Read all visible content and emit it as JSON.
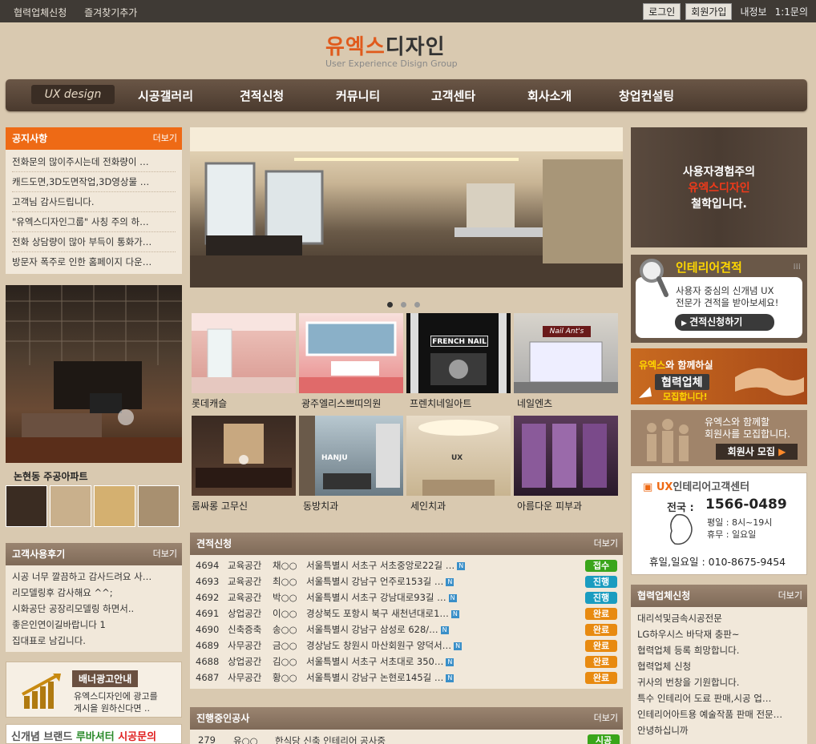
{
  "topbar": {
    "left": [
      "협력업체신청",
      "즐겨찾기추가"
    ],
    "login": "로그인",
    "join": "회원가입",
    "myinfo": "내정보",
    "qna": "1:1문의"
  },
  "logo": {
    "brand_part1": "유엑스",
    "brand_part2": "디자인",
    "sub": "User Experience Disign Group"
  },
  "nav": {
    "home": "UX design",
    "items": [
      "시공갤러리",
      "견적신청",
      "커뮤니티",
      "고객센타",
      "회사소개",
      "창업컨설팅"
    ]
  },
  "notice": {
    "title": "공지사항",
    "more": "더보기",
    "items": [
      "전화문의 많이주시는데 전화량이 …",
      "캐드도면,3D도면작업,3D영상물 …",
      "고객님 감사드립니다.",
      "\"유엑스디자인그룹\" 사칭 주의 하…",
      "전화 상담량이 많아 부득이 통화가…",
      "방문자 폭주로 인한 홈페이지 다운…"
    ]
  },
  "feature": {
    "caption": "논현동 주공아파트"
  },
  "reviews": {
    "title": "고객사용후기",
    "more": "더보기",
    "items": [
      "시공 너무 깔끔하고 감사드려요 사…",
      "리모델링후 감사해요 ^^;",
      "시화공단 공장리모델링 하면서..",
      "좋은인연이길바랍니다 1",
      "집대표로 남깁니다."
    ]
  },
  "banner_ad": {
    "title": "배너광고안내",
    "line1": "유엑스디자인에 광고를",
    "line2": "게시을 원하신다면 .."
  },
  "brand_strip": {
    "text1": "신개념 브랜드",
    "text2": "루바셔터",
    "text3": "시공문의"
  },
  "slider": {
    "dots": 3,
    "active": 0
  },
  "gallery": [
    {
      "caption": "롯데캐슬"
    },
    {
      "caption": "광주엘리스쁘띠의원"
    },
    {
      "caption": "프렌치네일아트"
    },
    {
      "caption": "네일엔츠"
    },
    {
      "caption": "룸싸롱 고무신"
    },
    {
      "caption": "동방치과"
    },
    {
      "caption": "세인치과"
    },
    {
      "caption": "아름다운 피부과"
    }
  ],
  "gallery_signs": {
    "french": "FRENCH NAIL",
    "nailants": "Nail Ant's",
    "hanju": "HANJU",
    "ux": "UX"
  },
  "estimate": {
    "title": "견적신청",
    "more": "더보기",
    "rows": [
      {
        "no": "4694",
        "type": "교육공간",
        "name": "채○○",
        "addr": "서울특별시 서초구 서초중앙로22길 …",
        "status": "접수",
        "color": "#3aa51a"
      },
      {
        "no": "4693",
        "type": "교육공간",
        "name": "최○○",
        "addr": "서울특별시 강남구 언주로153길 …",
        "status": "진행",
        "color": "#1a9cc0"
      },
      {
        "no": "4692",
        "type": "교육공간",
        "name": "박○○",
        "addr": "서울특별시 서초구 강남대로93길 …",
        "status": "진행",
        "color": "#1a9cc0"
      },
      {
        "no": "4691",
        "type": "상업공간",
        "name": "이○○",
        "addr": "경상북도 포항시 북구 새천년대로1…",
        "status": "완료",
        "color": "#e88a10"
      },
      {
        "no": "4690",
        "type": "신축증축",
        "name": "송○○",
        "addr": "서울특별시 강남구 삼성로 628/…",
        "status": "완료",
        "color": "#e88a10"
      },
      {
        "no": "4689",
        "type": "사무공간",
        "name": "금○○",
        "addr": "경상남도 창원시 마산회원구 양덕서…",
        "status": "완료",
        "color": "#e88a10"
      },
      {
        "no": "4688",
        "type": "상업공간",
        "name": "김○○",
        "addr": "서울특별시 서초구 서초대로 350…",
        "status": "완료",
        "color": "#e88a10"
      },
      {
        "no": "4687",
        "type": "사무공간",
        "name": "황○○",
        "addr": "서울특별시 강남구 논현로145길 …",
        "status": "완료",
        "color": "#e88a10"
      }
    ],
    "new_icon": "N"
  },
  "ongoing": {
    "title": "진행중인공사",
    "more": "더보기",
    "row": {
      "no": "279",
      "name": "유○○",
      "desc": "한식당 신축 인테리어 공사중",
      "status": "시공"
    }
  },
  "right": {
    "philosophy": {
      "l1": "사용자경험주의",
      "l2": "유엑스디자인",
      "l3": "철학입니다."
    },
    "quote": {
      "title": "인테리어견적",
      "l1": "사용자 중심의 신개념 UX",
      "l2": "전문가 견적을 받아보세요!",
      "btn": "견적신청하기"
    },
    "partner": {
      "l1a": "유엑스",
      "l1b": "와 함께하실",
      "l2": "협력업체",
      "l3": "모집합니다!"
    },
    "member": {
      "l1": "유엑스와 함께할",
      "l2": "회원사를 모집합니다.",
      "btn": "회원사 모집"
    },
    "cs": {
      "title_ux": "UX",
      "title": "인테리어고객센터",
      "nat_label": "전국 :",
      "phone": "1566-0489",
      "weekday": "평일 : 8시~19시",
      "holiday_label": "휴무 : 일요일",
      "sun": "휴일,일요일 : 010-8675-9454"
    },
    "partner_apply": {
      "title": "협력업체신청",
      "more": "더보기",
      "items": [
        "대리석및금속시공전문",
        "LG하우시스 바닥재 충판~",
        "협력업체 등록 희망합니다.",
        "협력업체 신청",
        "귀사의 번창을 기원합니다.",
        "특수 인테리어 도료 판매,시공 업…",
        "인테리어아트용 예술작품 판매 전문…",
        "안녕하십니까"
      ]
    }
  },
  "colors": {
    "accent": "#ee6a15",
    "nav": "#4a3a2e",
    "panel": "#f1e8da"
  }
}
